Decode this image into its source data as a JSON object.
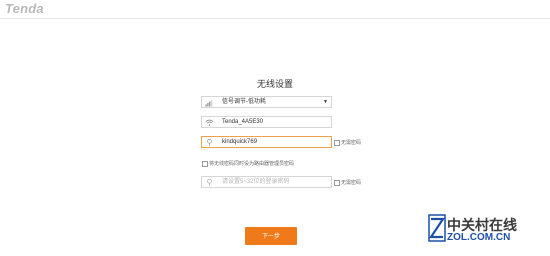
{
  "header": {
    "logo": "Tenda"
  },
  "page": {
    "title": "无线设置"
  },
  "signal": {
    "value": "信号调节-低功耗"
  },
  "ssid": {
    "value": "Tenda_4A5E30"
  },
  "wifi_password": {
    "value": "kindquick769",
    "no_password_label": "无需密码"
  },
  "sync_option": {
    "label": "将无线密码同时设为路由器管理员密码"
  },
  "admin_password": {
    "placeholder": "请设置5~32位的登录密码",
    "no_password_label": "无需密码"
  },
  "actions": {
    "next_label": "下一步"
  },
  "watermark": {
    "name": "中关村在线",
    "url": "ZOL.COM.CN"
  },
  "colors": {
    "accent": "#f07a1a",
    "focus_border": "#f0a24a",
    "watermark_blue": "#1d4fa8"
  }
}
